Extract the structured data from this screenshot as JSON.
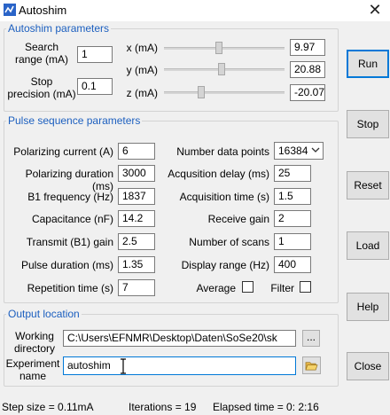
{
  "window": {
    "title": "Autoshim",
    "close_glyph": "✕"
  },
  "autoshim": {
    "legend": "Autoshim parameters",
    "search_range": {
      "label_line1": "Search",
      "label_line2": "range (mA)",
      "value": "1"
    },
    "stop_precision": {
      "label_line1": "Stop",
      "label_line2": "precision (mA)",
      "value": "0.1"
    },
    "x": {
      "label": "x (mA)",
      "value": "9.97",
      "slider_level": 0.45
    },
    "y": {
      "label": "y (mA)",
      "value": "20.88",
      "slider_level": 0.48
    },
    "z": {
      "label": "z (mA)",
      "value": "-20.07",
      "slider_level": 0.3
    }
  },
  "pulse": {
    "legend": "Pulse sequence parameters",
    "left": [
      {
        "label": "Polarizing current (A)",
        "value": "6"
      },
      {
        "label": "Polarizing duration (ms)",
        "value": "3000"
      },
      {
        "label": "B1 frequency (Hz)",
        "value": "1837"
      },
      {
        "label": "Capacitance (nF)",
        "value": "14.2"
      },
      {
        "label": "Transmit (B1) gain",
        "value": "2.5"
      },
      {
        "label": "Pulse duration (ms)",
        "value": "1.35"
      },
      {
        "label": "Repetition time (s)",
        "value": "7"
      }
    ],
    "number_data_points": {
      "label": "Number data points",
      "value": "16384"
    },
    "right": [
      {
        "label": "Acqusition delay (ms)",
        "value": "25"
      },
      {
        "label": "Acquisition time (s)",
        "value": "1.5"
      },
      {
        "label": "Receive gain",
        "value": "2"
      },
      {
        "label": "Number of scans",
        "value": "1"
      },
      {
        "label": "Display range (Hz)",
        "value": "400"
      }
    ],
    "average": {
      "label": "Average",
      "checked": false
    },
    "filter": {
      "label": "Filter",
      "checked": false
    }
  },
  "output": {
    "legend": "Output location",
    "working_directory": {
      "label_line1": "Working",
      "label_line2": "directory",
      "value": "C:\\Users\\EFNMR\\Desktop\\Daten\\SoSe20\\sk",
      "browse_label": "..."
    },
    "experiment_name": {
      "label_line1": "Experiment",
      "label_line2": "name",
      "value": "autoshim"
    }
  },
  "buttons": {
    "run": "Run",
    "stop": "Stop",
    "reset": "Reset",
    "load": "Load",
    "help": "Help",
    "close": "Close"
  },
  "status": {
    "step_size": "Step size = 0.11mA",
    "iterations": "Iterations = 19",
    "elapsed": "Elapsed time = 0: 2:16"
  },
  "colors": {
    "legend": "#1c5fbf",
    "primary_border": "#0078d7",
    "folder_icon": "#e8b84a"
  }
}
